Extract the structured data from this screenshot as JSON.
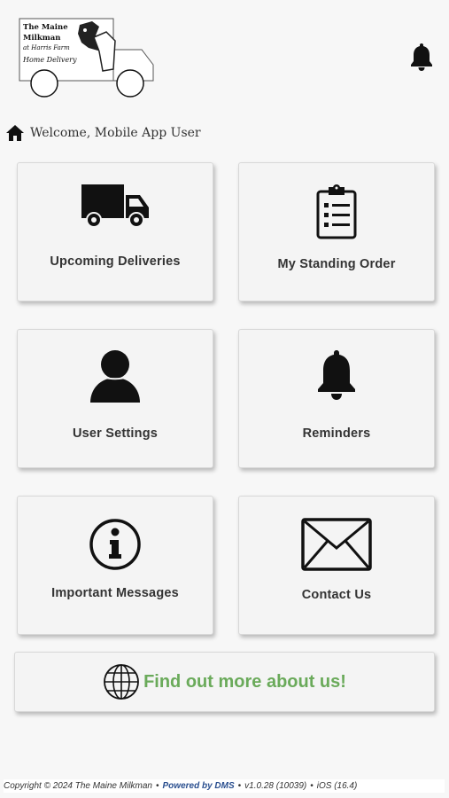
{
  "header": {
    "logo": {
      "line1": "The Maine",
      "line2": "Milkman",
      "line3": "at Harris Farm",
      "line4": "Home Delivery"
    },
    "bell_icon": "bell-icon"
  },
  "welcome": {
    "text": "Welcome, Mobile App User",
    "icon": "home-icon"
  },
  "tiles": [
    {
      "label": "Upcoming Deliveries",
      "icon": "truck-icon"
    },
    {
      "label": "My Standing Order",
      "icon": "clipboard-icon"
    },
    {
      "label": "User Settings",
      "icon": "user-icon"
    },
    {
      "label": "Reminders",
      "icon": "bell-icon"
    },
    {
      "label": "Important Messages",
      "icon": "info-icon"
    },
    {
      "label": "Contact Us",
      "icon": "envelope-icon"
    }
  ],
  "find": {
    "label": "Find out more about us!",
    "icon": "globe-icon",
    "color": "#6aaa5a"
  },
  "footer": {
    "copyright": "Copyright © 2024 The Maine Milkman",
    "powered": "Powered by DMS",
    "version": "v1.0.28 (10039)",
    "platform": "iOS (16.4)"
  }
}
